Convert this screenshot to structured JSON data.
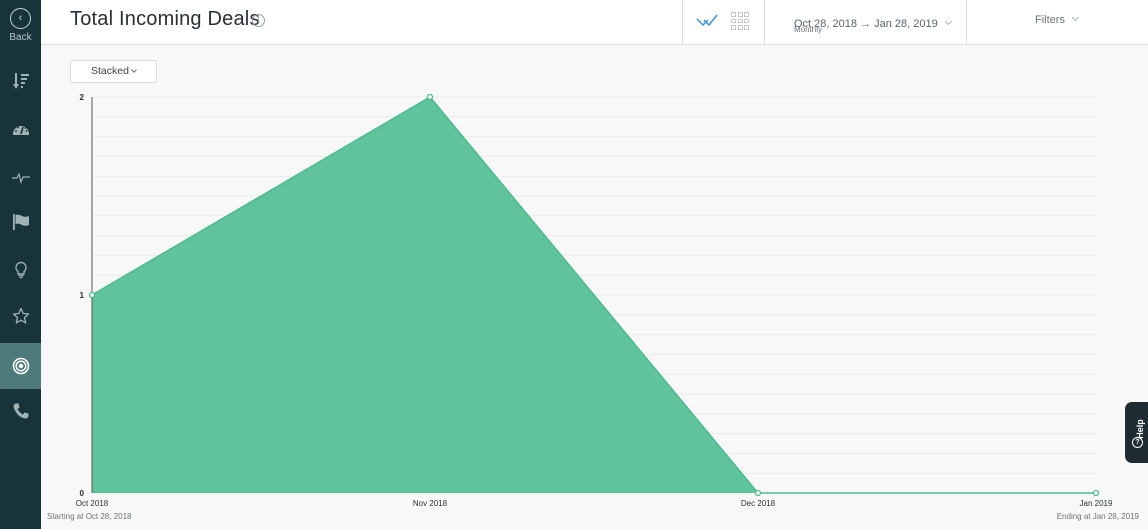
{
  "sidebar": {
    "back_label": "Back",
    "items": [
      {
        "name": "sort-icon",
        "active": false
      },
      {
        "name": "dashboard-icon",
        "active": false
      },
      {
        "name": "pulse-icon",
        "active": false
      },
      {
        "name": "flag-icon",
        "active": false
      },
      {
        "name": "lightbulb-icon",
        "active": false
      },
      {
        "name": "star-icon",
        "active": false
      },
      {
        "name": "target-icon",
        "active": true
      },
      {
        "name": "phone-icon",
        "active": false
      }
    ]
  },
  "header": {
    "title": "Total Incoming Deals",
    "info_icon": "i",
    "date_range": "Oct 28, 2018 → Jan 28, 2019",
    "interval": "Monthly",
    "filters_label": "Filters"
  },
  "controls": {
    "stacked_label": "Stacked"
  },
  "help": {
    "label": "Help",
    "icon": "?"
  },
  "colors": {
    "sidebar_bg": "#17343b",
    "sidebar_active": "#4f7a7c",
    "area_fill": "#5fc49c",
    "area_stroke": "#4fb98e",
    "accent_blue": "#3f8fd2"
  },
  "chart_data": {
    "type": "area",
    "title": "Total Incoming Deals",
    "mode": "Stacked",
    "categories": [
      "Oct 2018",
      "Nov 2018",
      "Dec 2018",
      "Jan 2019"
    ],
    "series": [
      {
        "name": "Incoming Deals",
        "values": [
          1,
          2,
          0,
          0
        ]
      }
    ],
    "ylim": [
      0,
      2
    ],
    "yticks": [
      "0",
      "1",
      "2"
    ],
    "xlabel": "",
    "ylabel": "",
    "grid": true,
    "start_note": "Starting at Oct 28, 2018",
    "end_note": "Ending at Jan 28, 2019"
  }
}
